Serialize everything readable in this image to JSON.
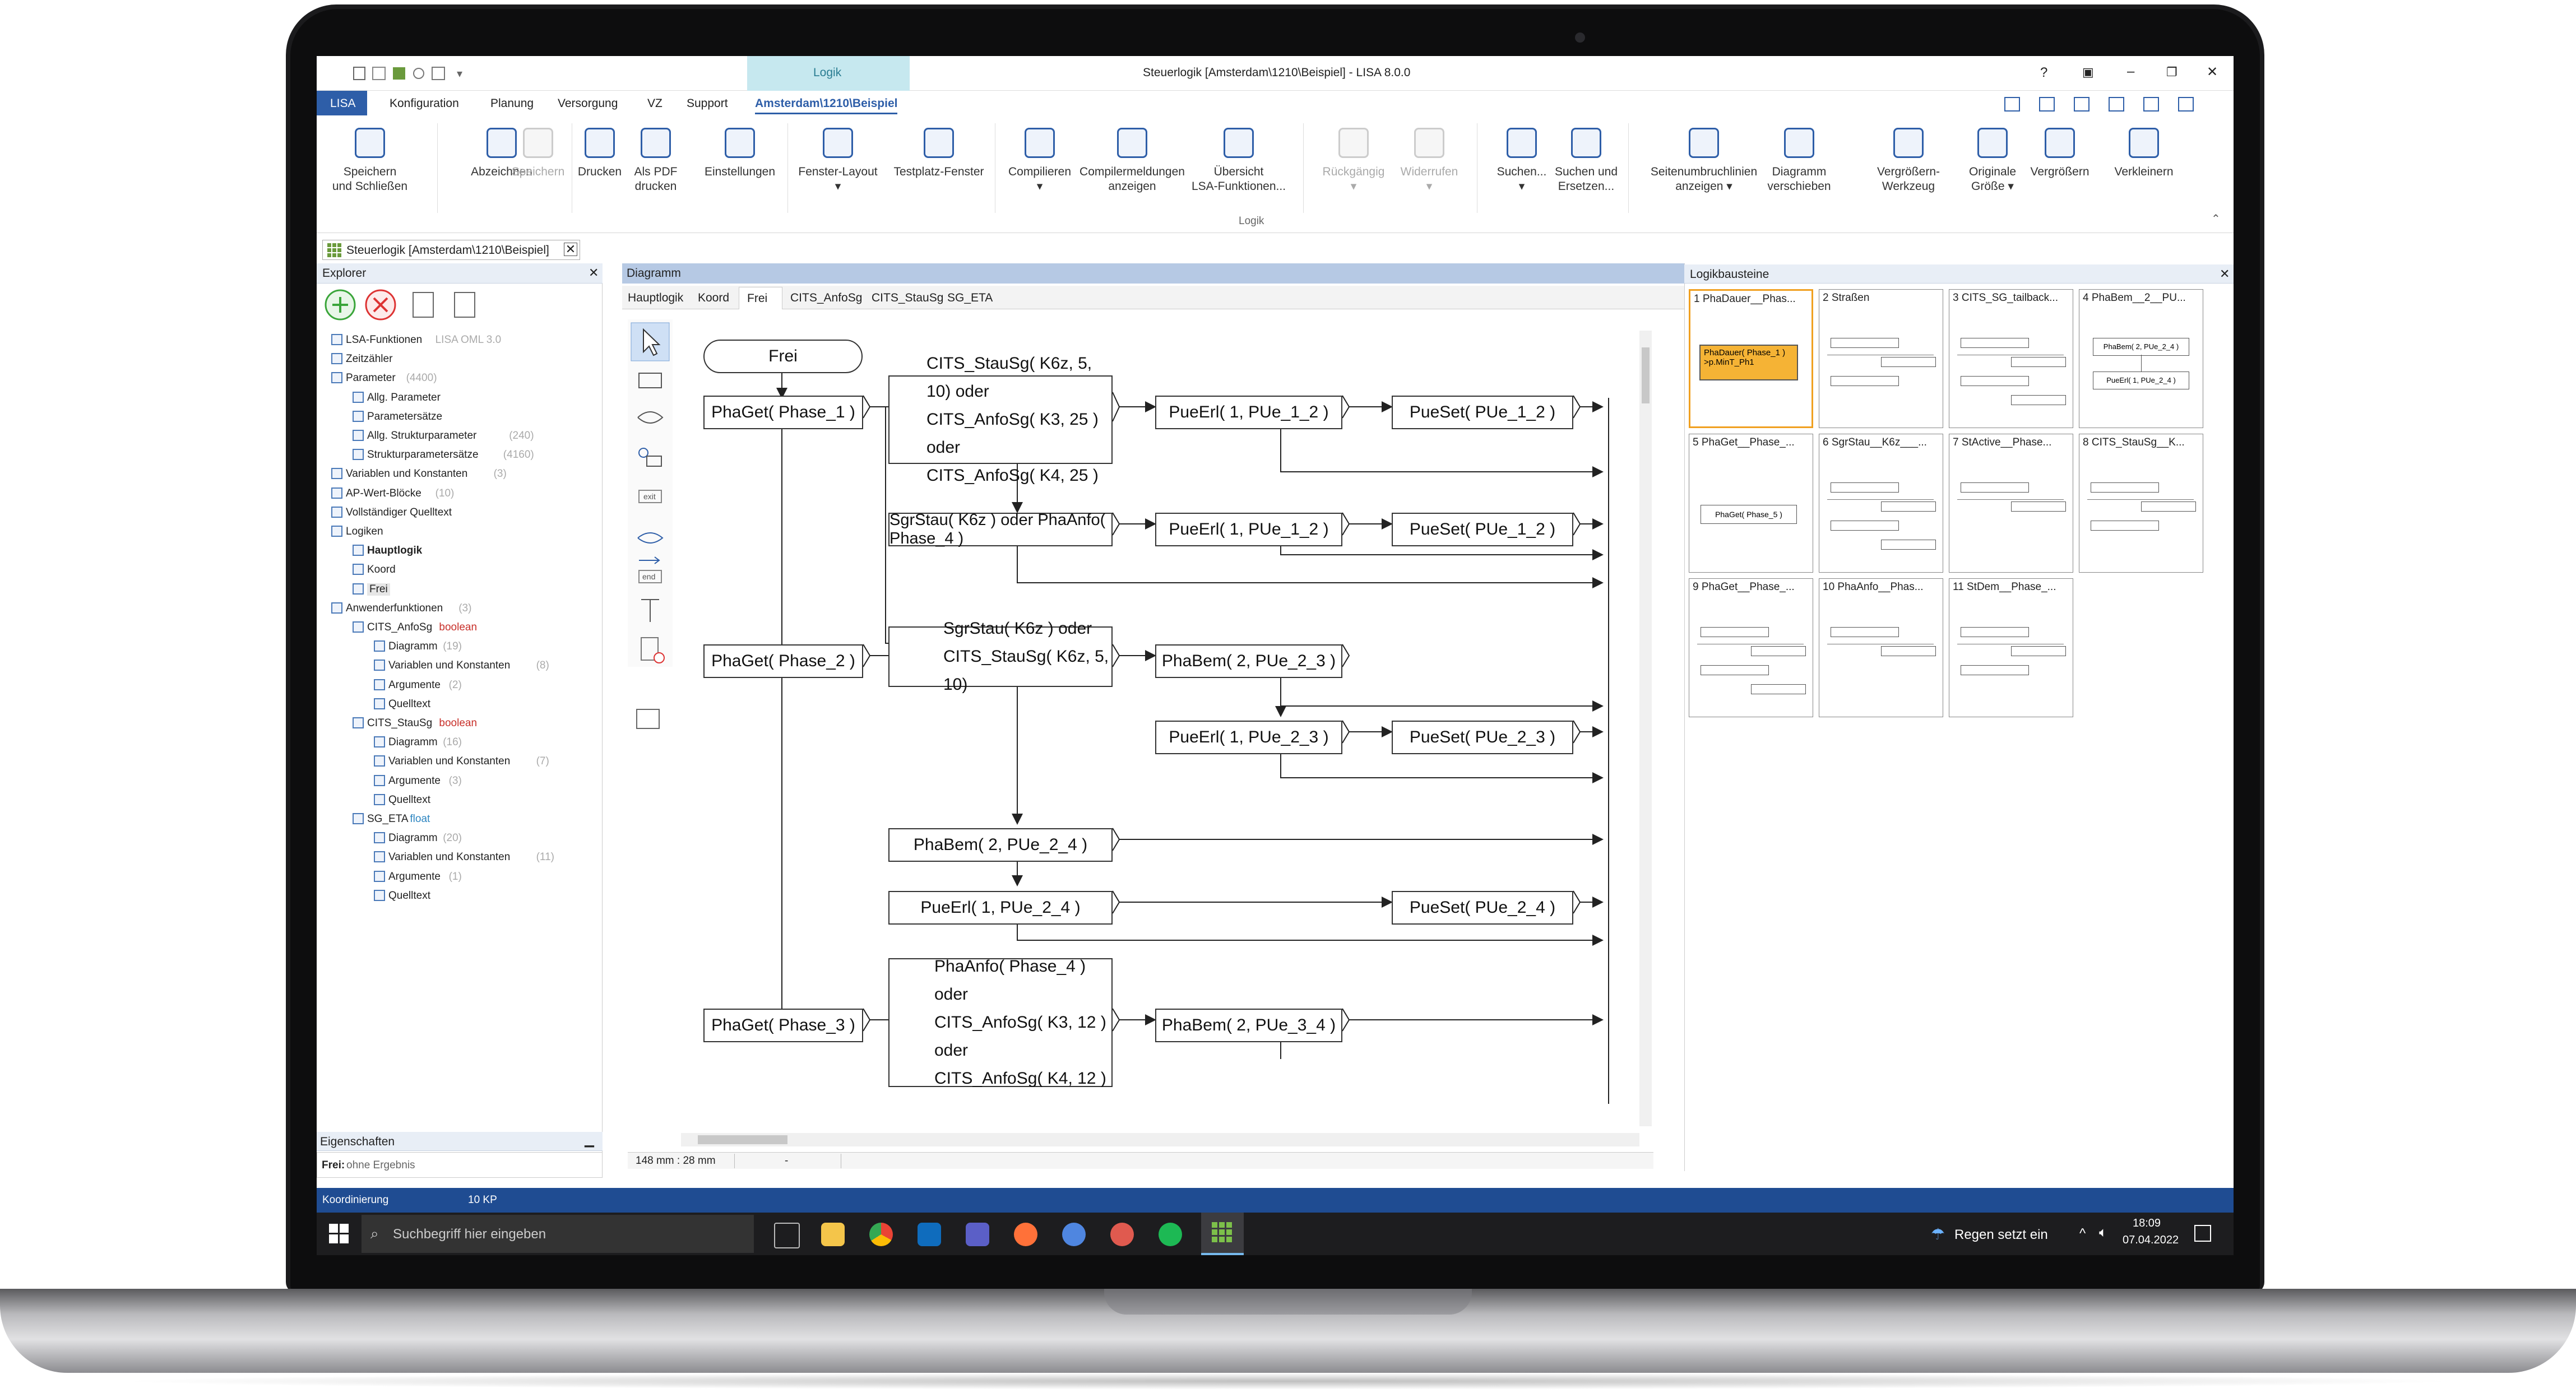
{
  "window": {
    "title": "Steuerlogik [Amsterdam\\1210\\Beispiel] - LISA 8.0.0",
    "context_tab": "Logik",
    "controls": [
      "?",
      "▣",
      "–",
      "❐",
      "✕"
    ]
  },
  "menu": {
    "items": [
      "LISA",
      "Konfiguration",
      "Planung",
      "Versorgung",
      "VZ",
      "Support",
      "Amsterdam\\1210\\Beispiel"
    ]
  },
  "ribbon": {
    "buttons": [
      {
        "label": "Speichern und Schließen",
        "l1": "Speichern",
        "l2": "und Schließen"
      },
      {
        "label": "Abzeichnen",
        "l1": "Abzeichnen",
        "l2": ""
      },
      {
        "label": "Speichern",
        "l1": "Speichern",
        "l2": ""
      },
      {
        "label": "Drucken",
        "l1": "Drucken",
        "l2": ""
      },
      {
        "label": "Als PDF drucken",
        "l1": "Als PDF",
        "l2": "drucken"
      },
      {
        "label": "Einstellungen",
        "l1": "Einstellungen",
        "l2": ""
      },
      {
        "label": "Fenster-Layout",
        "l1": "Fenster-Layout",
        "l2": "▾"
      },
      {
        "label": "Testplatz-Fenster",
        "l1": "Testplatz-Fenster",
        "l2": ""
      },
      {
        "label": "Compilieren",
        "l1": "Compilieren",
        "l2": "▾"
      },
      {
        "label": "Compilermeldungen anzeigen",
        "l1": "Compilermeldungen",
        "l2": "anzeigen"
      },
      {
        "label": "Übersicht LSA-Funktionen...",
        "l1": "Übersicht",
        "l2": "LSA-Funktionen..."
      },
      {
        "label": "Rückgängig",
        "l1": "Rückgängig",
        "l2": "▾"
      },
      {
        "label": "Widerrufen",
        "l1": "Widerrufen",
        "l2": "▾"
      },
      {
        "label": "Suchen...",
        "l1": "Suchen...",
        "l2": "▾"
      },
      {
        "label": "Suchen und Ersetzen...",
        "l1": "Suchen und",
        "l2": "Ersetzen..."
      },
      {
        "label": "Seitenumbruchlinien anzeigen",
        "l1": "Seitenumbruchlinien",
        "l2": "anzeigen ▾"
      },
      {
        "label": "Diagramm verschieben",
        "l1": "Diagramm",
        "l2": "verschieben"
      },
      {
        "label": "Vergrößern-Werkzeug",
        "l1": "Vergrößern-Werkzeug",
        "l2": ""
      },
      {
        "label": "Originale Größe",
        "l1": "Originale",
        "l2": "Größe ▾"
      },
      {
        "label": "Vergrößern",
        "l1": "Vergrößern",
        "l2": ""
      },
      {
        "label": "Verkleinern",
        "l1": "Verkleinern",
        "l2": ""
      }
    ],
    "group_label": "Logik"
  },
  "document_tab": "Steuerlogik [Amsterdam\\1210\\Beispiel]",
  "explorer": {
    "title": "Explorer",
    "tree": [
      {
        "label": "LSA-Funktionen",
        "note": "LISA OML 3.0",
        "level": 1,
        "bold": false
      },
      {
        "label": "Zeitzähler",
        "note": "",
        "level": 1,
        "bold": false
      },
      {
        "label": "Parameter",
        "note": "(4400)",
        "level": 1,
        "bold": false
      },
      {
        "label": "Allg. Parameter",
        "note": "",
        "level": 2,
        "bold": false
      },
      {
        "label": "Parametersätze",
        "note": "",
        "level": 2,
        "bold": false
      },
      {
        "label": "Allg. Strukturparameter",
        "note": "(240)",
        "level": 2,
        "bold": false
      },
      {
        "label": "Strukturparametersätze",
        "note": "(4160)",
        "level": 2,
        "bold": false
      },
      {
        "label": "Variablen und Konstanten",
        "note": "(3)",
        "level": 1,
        "bold": false
      },
      {
        "label": "AP-Wert-Blöcke",
        "note": "(10)",
        "level": 1,
        "bold": false
      },
      {
        "label": "Vollständiger Quelltext",
        "note": "",
        "level": 1,
        "bold": false
      },
      {
        "label": "Logiken",
        "note": "",
        "level": 1,
        "bold": false
      },
      {
        "label": "Hauptlogik",
        "note": "",
        "level": 2,
        "bold": true
      },
      {
        "label": "Koord",
        "note": "",
        "level": 2,
        "bold": false
      },
      {
        "label": "Frei",
        "note": "",
        "level": 2,
        "bold": false
      },
      {
        "label": "Anwenderfunktionen",
        "note": "(3)",
        "level": 1,
        "bold": false
      },
      {
        "label": "CITS_AnfoSg",
        "note": "boolean",
        "level": 2,
        "bold": false
      },
      {
        "label": "Diagramm",
        "note": "(19)",
        "level": 3,
        "bold": false
      },
      {
        "label": "Variablen und Konstanten",
        "note": "(8)",
        "level": 3,
        "bold": false
      },
      {
        "label": "Argumente",
        "note": "(2)",
        "level": 3,
        "bold": false
      },
      {
        "label": "Quelltext",
        "note": "",
        "level": 3,
        "bold": false
      },
      {
        "label": "CITS_StauSg",
        "note": "boolean",
        "level": 2,
        "bold": false
      },
      {
        "label": "Diagramm",
        "note": "(16)",
        "level": 3,
        "bold": false
      },
      {
        "label": "Variablen und Konstanten",
        "note": "(7)",
        "level": 3,
        "bold": false
      },
      {
        "label": "Argumente",
        "note": "(3)",
        "level": 3,
        "bold": false
      },
      {
        "label": "Quelltext",
        "note": "",
        "level": 3,
        "bold": false
      },
      {
        "label": "SG_ETA",
        "note": "float",
        "level": 2,
        "bold": false
      },
      {
        "label": "Diagramm",
        "note": "(20)",
        "level": 3,
        "bold": false
      },
      {
        "label": "Variablen und Konstanten",
        "note": "(11)",
        "level": 3,
        "bold": false
      },
      {
        "label": "Argumente",
        "note": "(1)",
        "level": 3,
        "bold": false
      },
      {
        "label": "Quelltext",
        "note": "",
        "level": 3,
        "bold": false
      }
    ],
    "properties_title": "Eigenschaften",
    "properties_key": "Frei:",
    "properties_value": "ohne Ergebnis"
  },
  "diagram": {
    "title": "Diagramm",
    "tabs": [
      "Hauptlogik",
      "Koord",
      "Frei",
      "CITS_AnfoSg",
      "CITS_StauSg",
      "SG_ETA"
    ],
    "nodes": {
      "start": "Frei",
      "n1": "PhaGet( Phase_1 )",
      "n2a": "CITS_StauSg( K6z, 5, 10) oder",
      "n2b": "CITS_AnfoSg( K3, 25 ) oder",
      "n2c": "CITS_AnfoSg( K4, 25 )",
      "n3": "PueErl( 1, PUe_1_2 )",
      "n4": "PueSet( PUe_1_2 )",
      "n5": "SgrStau( K6z ) oder PhaAnfo( Phase_4 )",
      "n6": "PueErl( 1, PUe_1_2 )",
      "n7": "PueSet( PUe_1_2 )",
      "n8": "PhaGet( Phase_2 )",
      "n9a": "SgrStau( K6z ) oder",
      "n9b": "CITS_StauSg( K6z, 5, 10)",
      "n10": "PhaBem( 2, PUe_2_3 )",
      "n11": "PueErl( 1, PUe_2_3 )",
      "n12": "PueSet( PUe_2_3 )",
      "n13": "PhaBem( 2, PUe_2_4 )",
      "n14": "PueErl( 1, PUe_2_4 )",
      "n15": "PueSet( PUe_2_4 )",
      "n16": "PhaGet( Phase_3 )",
      "n17a": "PhaAnfo( Phase_4 )",
      "n17b": "oder",
      "n17c": "CITS_AnfoSg( K3, 12 ) oder",
      "n17d": "CITS_AnfoSg( K4, 12 )",
      "n18": "PhaBem( 2, PUe_3_4 )"
    },
    "status_left": "148 mm : 28 mm",
    "status_mid": "-"
  },
  "logikbausteine": {
    "title": "Logikbausteine",
    "items": [
      "1 PhaDauer__Phas...",
      "2 Straßen",
      "3 CITS_SG_tailback...",
      "4 PhaBem__2__PU...",
      "5 PhaGet__Phase_...",
      "6 SgrStau__K6z___...",
      "7 StActive__Phase...",
      "8 CITS_StauSg__K...",
      "9 PhaGet__Phase_...",
      "10 PhaAnfo__Phas...",
      "11 StDem__Phase_..."
    ],
    "preview1_line1": "PhaDauer( Phase_1 )",
    "preview1_line2": ">p.MinT_Ph1",
    "preview4_line1": "PhaBem( 2, PUe_2_4 )",
    "preview4_line2": "PueErl( 1, PUe_2_4 )",
    "preview5": "PhaGet( Phase_5 )"
  },
  "statusbar": {
    "left": "Koordinierung",
    "right": "10 KP"
  },
  "taskbar": {
    "search_placeholder": "Suchbegriff hier eingeben",
    "weather": "Regen setzt ein",
    "time": "18:09",
    "date": "07.04.2022"
  },
  "colors": {
    "accent": "#2e5ea8",
    "selected_block": "#f5b335",
    "logik_tab": "#c6e8ef",
    "status_bar": "#1f4c92"
  }
}
